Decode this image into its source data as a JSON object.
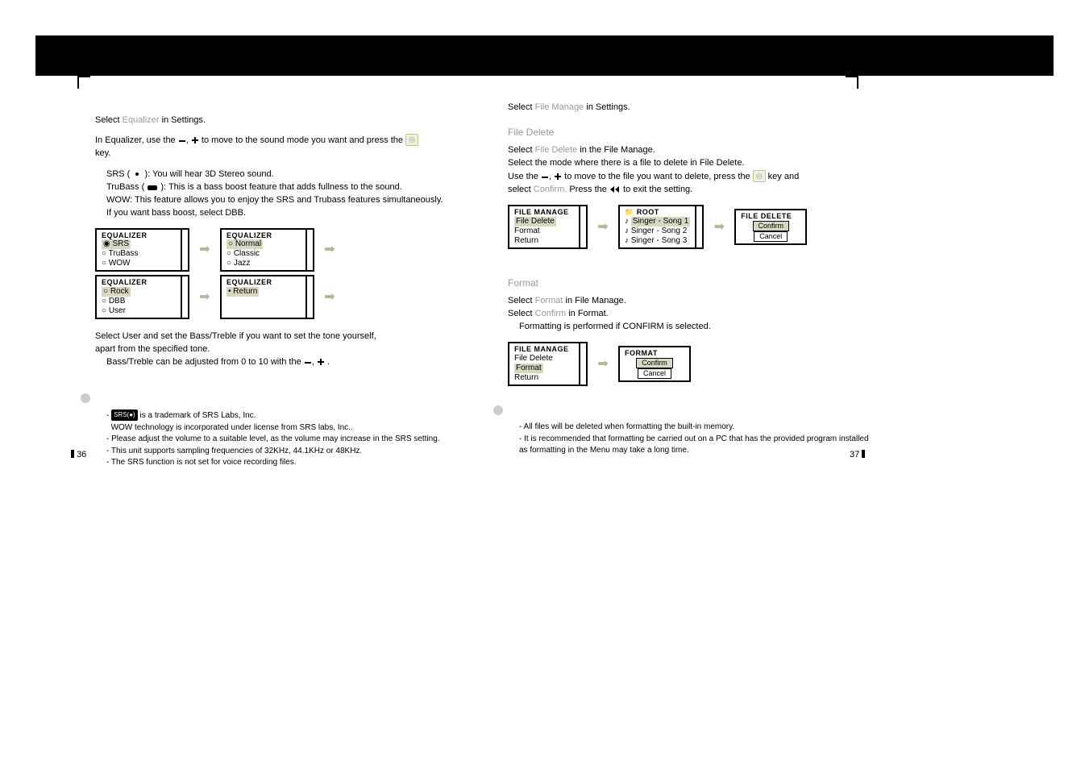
{
  "left": {
    "line1_a": "Select ",
    "line1_b": "Equalizer",
    "line1_c": " in Settings.",
    "para1": "In Equalizer, use the ",
    "para1b": "to move to the sound mode you want and press the ",
    "para1c": "key.",
    "srs": "SRS ( ",
    "srs2": " ): You will hear 3D Stereo sound.",
    "trubass": "TruBass ( ",
    "trubass2": " ): This is a bass boost feature that adds fullness to the sound.",
    "wow": "WOW: This feature allows you to enjoy the SRS and Trubass features simultaneously.",
    "dbb": "If you want bass boost, select DBB.",
    "eq": {
      "a": {
        "t": "EQUALIZER",
        "i": [
          "◉ SRS",
          "○ TruBass",
          "○ WOW"
        ]
      },
      "b": {
        "t": "EQUALIZER",
        "i": [
          "○ Normal",
          "○ Classic",
          "○ Jazz"
        ]
      },
      "c": {
        "t": "EQUALIZER",
        "i": [
          "○ Rock",
          "○ DBB",
          "○ User"
        ]
      },
      "d": {
        "t": "EQUALIZER",
        "i": [
          "• Return"
        ]
      }
    },
    "user1": "Select User and set the Bass/Treble if you want to set the tone yourself,",
    "user2": "apart from the specified tone.",
    "bass": "Bass/Treble can be adjusted from 0 to 10 with the ",
    "notes": {
      "n1": " is a trademark of SRS Labs, Inc.",
      "n1b": "WOW technology is incorporated under license from SRS labs, Inc..",
      "n2": "- Please adjust the volume to a suitable level, as the volume may increase in the SRS setting.",
      "n3": "- This unit supports sampling frequencies of 32KHz, 44.1KHz or 48KHz.",
      "n4": "- The SRS function is not set for voice recording files."
    }
  },
  "right": {
    "top_a": "Select ",
    "top_b": "File Manage",
    "top_c": " in Settings.",
    "fd": {
      "heading": "File Delete",
      "s1a": "Select ",
      "s1b": "File Delete",
      "s1c": " in the File Manage.",
      "s2": "Select the mode where there is a file to delete in File Delete.",
      "s3a": "Use the ",
      "s3b": " to move to the file you want to delete, press the ",
      "s3c": " key and",
      "s4a": "select ",
      "s4b": "Confirm.",
      "s4c": " Press the ",
      "s4d": " to exit the setting.",
      "panelA": {
        "t": "FILE MANAGE",
        "i": [
          "File Delete",
          "Format",
          "Return"
        ]
      },
      "panelB": {
        "t": "ROOT",
        "i": [
          "Singer - Song 1",
          "Singer - Song 2",
          "Singer - Song 3"
        ]
      },
      "panelC": {
        "t": "FILE DELETE",
        "c": "Confirm",
        "x": "Cancel"
      }
    },
    "fmt": {
      "heading": "Format",
      "s1a": "Select ",
      "s1b": "Format",
      "s1c": " in File Manage.",
      "s2a": "Select ",
      "s2b": "Confirm",
      "s2c": " in Format.",
      "s3": "Formatting is performed if CONFIRM is selected.",
      "panelA": {
        "t": "FILE MANAGE",
        "i": [
          "File Delete",
          "Format",
          "Return"
        ]
      },
      "panelB": {
        "t": "FORMAT",
        "c": "Confirm",
        "x": "Cancel"
      }
    },
    "notes": {
      "n1": "- All files will be deleted when formatting the built-in memory.",
      "n2": "- It is recommended that formatting be carried out on a PC that has the provided program installed",
      "n2b": "  as formatting in the Menu may take a long time."
    }
  },
  "pages": {
    "l": "36",
    "r": "37"
  }
}
